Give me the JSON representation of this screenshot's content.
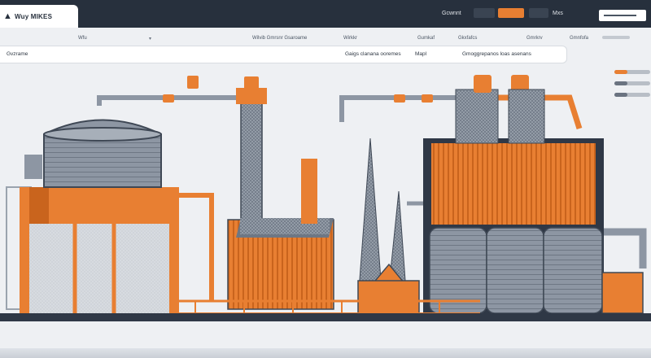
{
  "header": {
    "logo_text": "Wuy MIKES",
    "logo_icon": "flame-icon",
    "label_a": "Gcwnnt",
    "label_b": "Mxs"
  },
  "nav": {
    "items": [
      "Wfu",
      "Wilvib Gmrsnr Gsaroame",
      "Wirkkr",
      "Gumkaf",
      "Gkxfafcs",
      "Gmrkrv",
      "Gmnfofa"
    ]
  },
  "subnav": {
    "items": [
      "Gvzrame",
      "Gaigs clanana ooremes",
      "Mapl",
      "Gmoggrepanos loas asenans"
    ]
  },
  "colors": {
    "accent": "#e87f32",
    "dark": "#27303d",
    "steel": "#8d96a3"
  },
  "search": {
    "icon": "search-icon"
  }
}
